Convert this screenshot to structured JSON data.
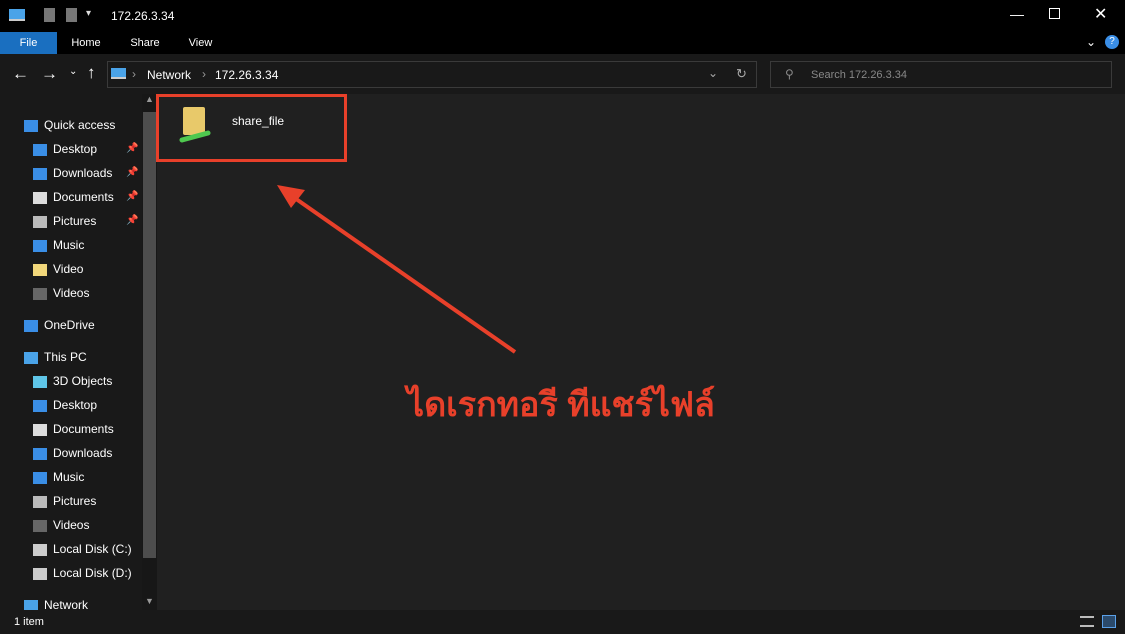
{
  "window": {
    "title": "172.26.3.34"
  },
  "ribbon": {
    "tabs": [
      "File",
      "Home",
      "Share",
      "View"
    ]
  },
  "address": {
    "crumbs": [
      "Network",
      "172.26.3.34"
    ]
  },
  "search": {
    "placeholder": "Search 172.26.3.34"
  },
  "sidebar": {
    "items": [
      {
        "label": "Quick access",
        "icon": "star-icon",
        "level": 0,
        "pinned": false
      },
      {
        "label": "Desktop",
        "icon": "desktop-icon",
        "level": 1,
        "pinned": true
      },
      {
        "label": "Downloads",
        "icon": "download-icon",
        "level": 1,
        "pinned": true
      },
      {
        "label": "Documents",
        "icon": "document-icon",
        "level": 1,
        "pinned": true
      },
      {
        "label": "Pictures",
        "icon": "pictures-icon",
        "level": 1,
        "pinned": true
      },
      {
        "label": "Music",
        "icon": "music-icon",
        "level": 1,
        "pinned": false
      },
      {
        "label": "Video",
        "icon": "folder-icon",
        "level": 1,
        "pinned": false
      },
      {
        "label": "Videos",
        "icon": "videos-icon",
        "level": 1,
        "pinned": false
      },
      {
        "label": "OneDrive",
        "icon": "cloud-icon",
        "level": 0,
        "pinned": false
      },
      {
        "label": "This PC",
        "icon": "pc-icon",
        "level": 0,
        "pinned": false
      },
      {
        "label": "3D Objects",
        "icon": "cube-icon",
        "level": 1,
        "pinned": false
      },
      {
        "label": "Desktop",
        "icon": "desktop-icon",
        "level": 1,
        "pinned": false
      },
      {
        "label": "Documents",
        "icon": "document-icon",
        "level": 1,
        "pinned": false
      },
      {
        "label": "Downloads",
        "icon": "download-icon",
        "level": 1,
        "pinned": false
      },
      {
        "label": "Music",
        "icon": "music-icon",
        "level": 1,
        "pinned": false
      },
      {
        "label": "Pictures",
        "icon": "pictures-icon",
        "level": 1,
        "pinned": false
      },
      {
        "label": "Videos",
        "icon": "videos-icon",
        "level": 1,
        "pinned": false
      },
      {
        "label": "Local Disk (C:)",
        "icon": "drive-icon",
        "level": 1,
        "pinned": false
      },
      {
        "label": "Local Disk (D:)",
        "icon": "drive-icon",
        "level": 1,
        "pinned": false
      },
      {
        "label": "Network",
        "icon": "network-icon",
        "level": 0,
        "pinned": false
      }
    ]
  },
  "content": {
    "items": [
      {
        "name": "share_file",
        "icon": "shared-folder-icon"
      }
    ]
  },
  "annotation": {
    "text": "ไดเรกทอรี ทีแชร์ไฟล์",
    "color": "#e8402a"
  },
  "status": {
    "count": "1 item"
  }
}
